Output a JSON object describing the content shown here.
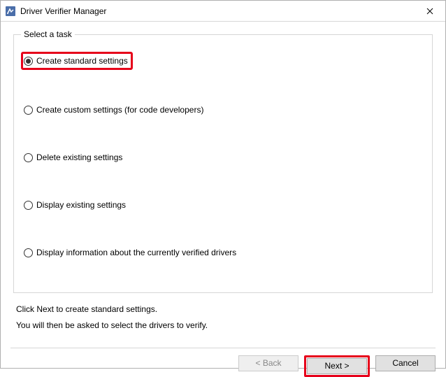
{
  "window": {
    "title": "Driver Verifier Manager"
  },
  "groupbox": {
    "label": "Select a task",
    "options": [
      {
        "label": "Create standard settings",
        "selected": true
      },
      {
        "label": "Create custom settings (for code developers)",
        "selected": false
      },
      {
        "label": "Delete existing settings",
        "selected": false
      },
      {
        "label": "Display existing settings",
        "selected": false
      },
      {
        "label": "Display information about the currently verified drivers",
        "selected": false
      }
    ]
  },
  "hints": {
    "line1": "Click Next to create standard settings.",
    "line2": "You will then be asked to select the drivers to verify."
  },
  "buttons": {
    "back": "< Back",
    "next": "Next >",
    "cancel": "Cancel"
  },
  "highlight": {
    "option_index": 0,
    "button": "next"
  }
}
